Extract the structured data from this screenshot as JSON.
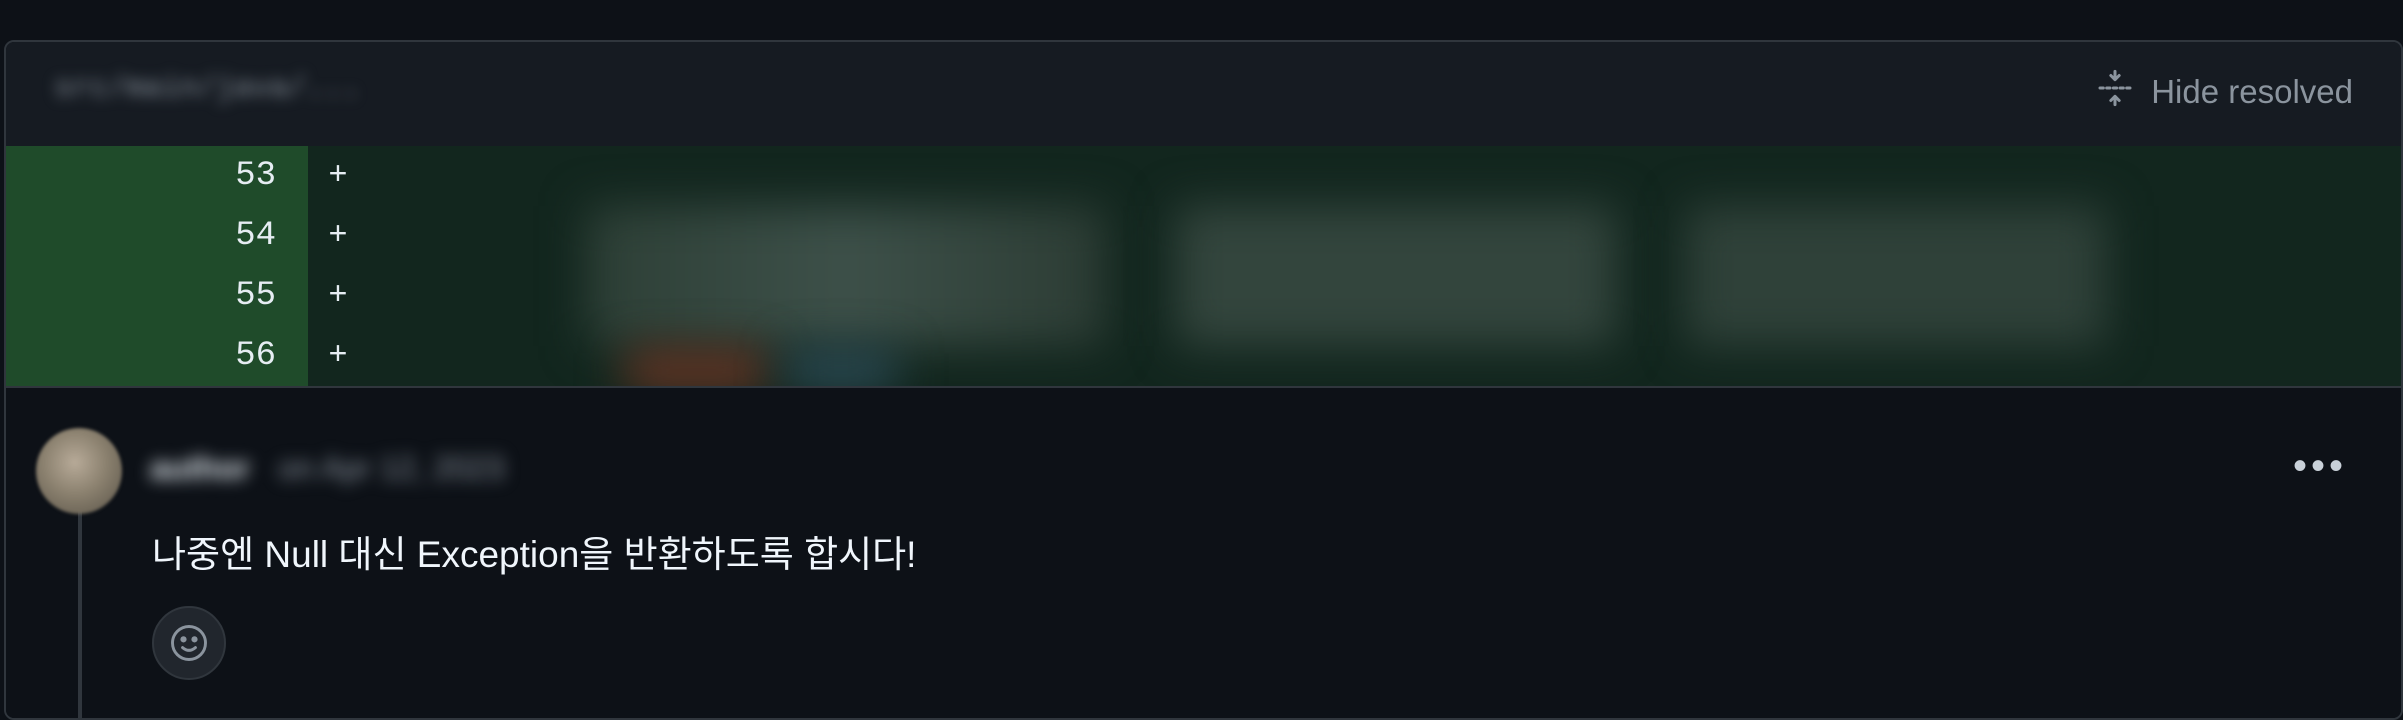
{
  "file_header": {
    "path": "src/main/java/...",
    "hide_resolved_label": "Hide resolved"
  },
  "diff": {
    "lines": [
      {
        "number": "53",
        "marker": "+"
      },
      {
        "number": "54",
        "marker": "+"
      },
      {
        "number": "55",
        "marker": "+"
      },
      {
        "number": "56",
        "marker": "+"
      }
    ]
  },
  "comment": {
    "author": "",
    "timestamp": "",
    "body": "나중엔 Null 대신 Exception을 반환하도록 합시다!",
    "more_label": "•••"
  },
  "icons": {
    "hide_resolved": "fold-icon",
    "reaction": "smiley-icon"
  },
  "colors": {
    "background": "#0d1117",
    "header": "#161b22",
    "diff_added_line_number": "#1f4b2a",
    "diff_added_code": "#12261e",
    "border": "#30363d",
    "muted_text": "#8b949e"
  }
}
